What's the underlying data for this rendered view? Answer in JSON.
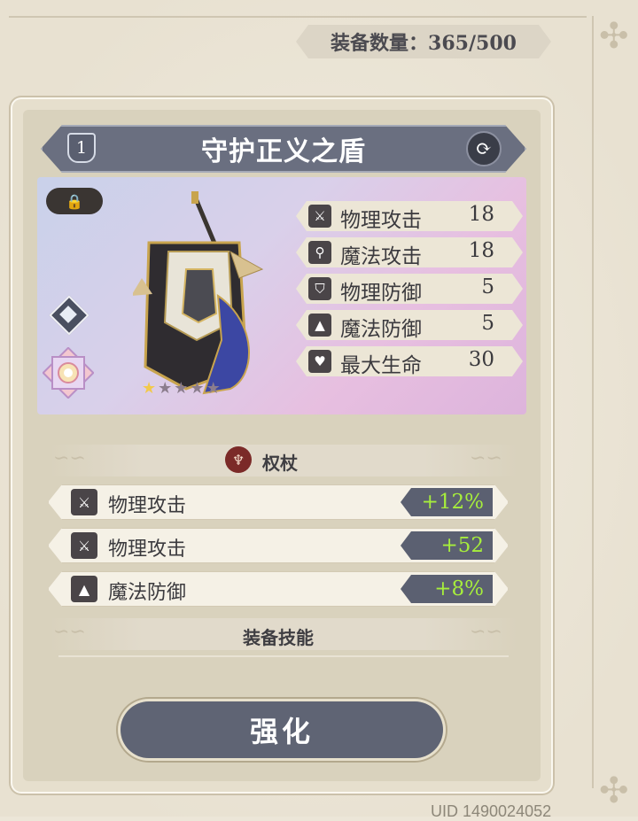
{
  "header": {
    "equipment_count": "装备数量：365/500"
  },
  "item": {
    "level": "1",
    "name": "守护正义之盾",
    "stars_filled": 1,
    "stars_total": 5,
    "lock_icon": "lock-icon",
    "swap_icon": "swap-icon"
  },
  "stats": [
    {
      "icon": "sword-icon",
      "label": "物理攻击",
      "value": "18"
    },
    {
      "icon": "staff-icon",
      "label": "魔法攻击",
      "value": "18"
    },
    {
      "icon": "shield-icon",
      "label": "物理防御",
      "value": "5"
    },
    {
      "icon": "wizard-hat-icon",
      "label": "魔法防御",
      "value": "5"
    },
    {
      "icon": "heart-icon",
      "label": "最大生命",
      "value": "30"
    }
  ],
  "weapon_type": {
    "label": "权杖",
    "icon": "scepter-icon"
  },
  "attributes": [
    {
      "icon": "sword-icon",
      "label": "物理攻击",
      "value": "+12%"
    },
    {
      "icon": "sword-icon",
      "label": "物理攻击",
      "value": "+52"
    },
    {
      "icon": "wizard-hat-icon",
      "label": "魔法防御",
      "value": "+8%"
    }
  ],
  "skills_section": {
    "label": "装备技能"
  },
  "actions": {
    "enhance_label": "强化"
  },
  "footer": {
    "uid": "UID 1490024052"
  },
  "colors": {
    "accent_green": "#a7ee3c",
    "panel_slate": "#5f6474"
  }
}
